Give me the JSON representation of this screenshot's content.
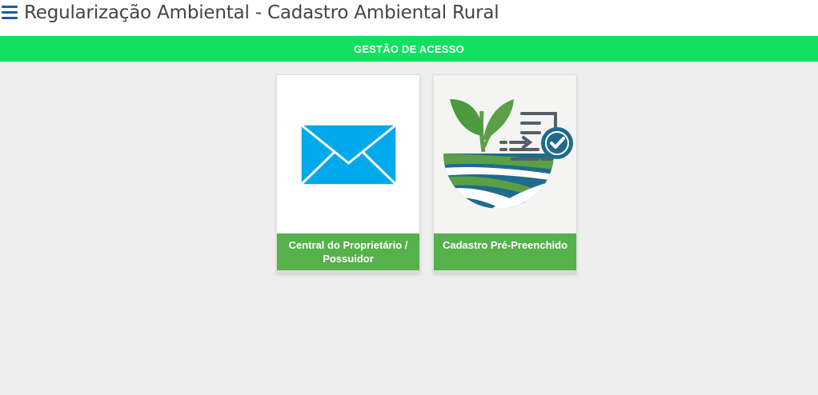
{
  "header": {
    "menu_icon": "hamburger-menu-icon",
    "title": "Regularização Ambiental - Cadastro Ambiental Rural"
  },
  "section": {
    "title": "GESTÃO DE ACESSO"
  },
  "cards": [
    {
      "label": "Central do Proprietário / Possuidor",
      "icon": "envelope-icon"
    },
    {
      "label": "Cadastro Pré-Preenchido",
      "icon": "plant-field-document-check-icon"
    }
  ],
  "colors": {
    "section_bar": "#12e060",
    "card_label": "#56b04b",
    "envelope": "#00a8ec",
    "menu_icon": "#1f5aa0"
  }
}
